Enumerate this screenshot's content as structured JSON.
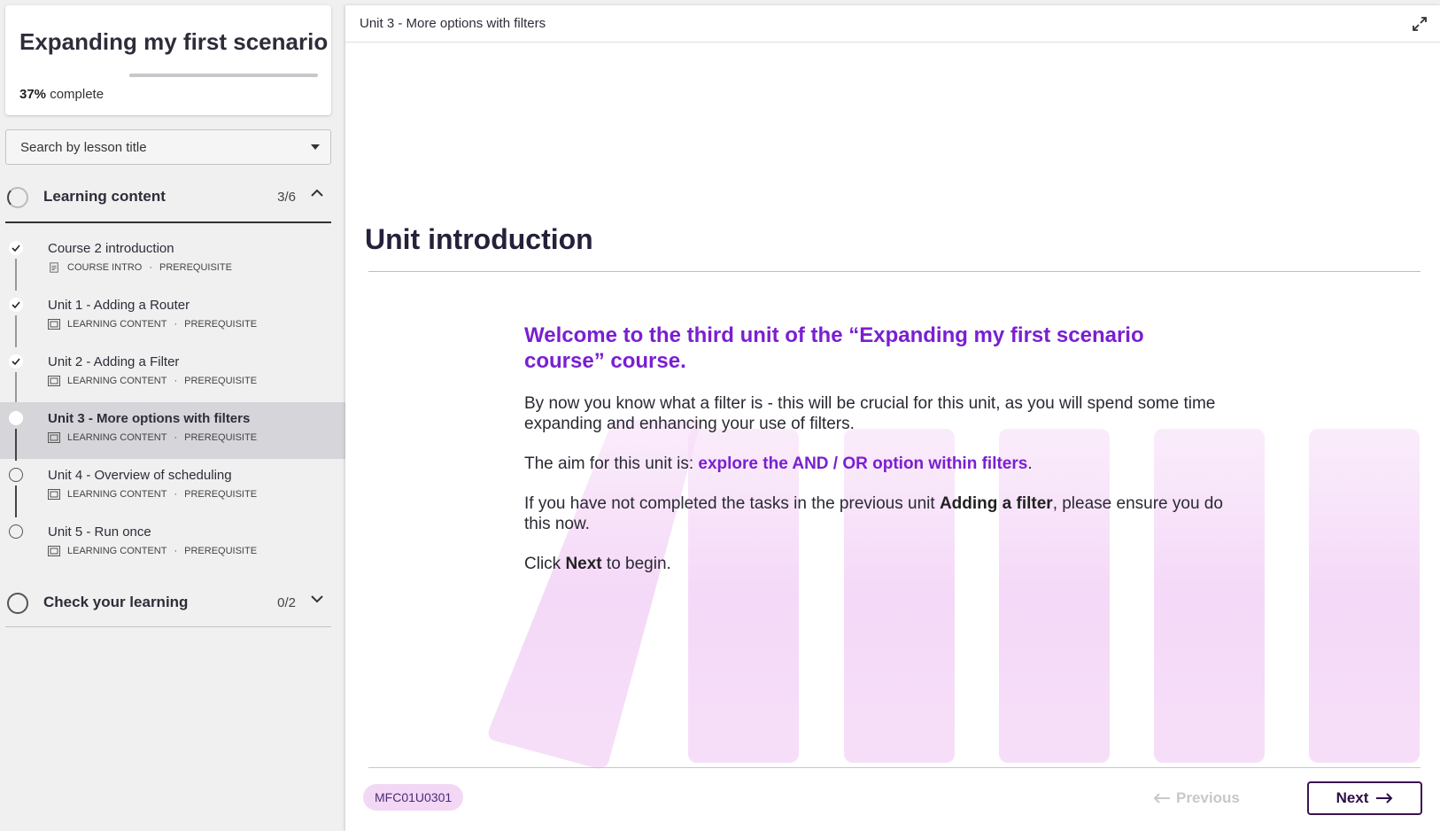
{
  "sidebar": {
    "course_title": "Expanding my first scenario",
    "progress_percent": "37%",
    "progress_suffix": "complete",
    "progress_value": 0.37,
    "search_placeholder": "Search by lesson title",
    "sections": [
      {
        "title": "Learning content",
        "count": "3/6",
        "expanded": true
      },
      {
        "title": "Check your learning",
        "count": "0/2",
        "expanded": false
      }
    ],
    "lessons": [
      {
        "name": "Course 2 introduction",
        "type": "COURSE INTRO",
        "tag": "PREREQUISITE",
        "status": "done"
      },
      {
        "name": "Unit 1 - Adding a Router",
        "type": "LEARNING CONTENT",
        "tag": "PREREQUISITE",
        "status": "done"
      },
      {
        "name": "Unit 2 - Adding a Filter",
        "type": "LEARNING CONTENT",
        "tag": "PREREQUISITE",
        "status": "done"
      },
      {
        "name": "Unit 3 - More options with filters",
        "type": "LEARNING CONTENT",
        "tag": "PREREQUISITE",
        "status": "current"
      },
      {
        "name": "Unit 4 - Overview of scheduling",
        "type": "LEARNING CONTENT",
        "tag": "PREREQUISITE",
        "status": "open"
      },
      {
        "name": "Unit 5 - Run once",
        "type": "LEARNING CONTENT",
        "tag": "PREREQUISITE",
        "status": "open"
      }
    ],
    "meta_separator": "·"
  },
  "main": {
    "breadcrumb": "Unit 3 - More options with filters",
    "heading": "Unit introduction",
    "welcome": "Welcome to the third unit of the “Expanding my first scenario course” course.",
    "para1": "By now you know what a filter is - this will be crucial for this unit, as you will spend some time expanding and enhancing your use of filters.",
    "para2_prefix": "The aim for this unit is: ",
    "para2_highlight": "explore the AND / OR option within filters",
    "para2_suffix": ".",
    "para3_prefix": "If you have not completed the tasks in the previous unit ",
    "para3_bold": "Adding a filter",
    "para3_suffix": ", please ensure you do this now.",
    "para4_prefix": "Click ",
    "para4_bold": "Next",
    "para4_suffix": " to begin.",
    "code": "MFC01U0301",
    "previous_label": "Previous",
    "next_label": "Next"
  },
  "colors": {
    "accent_purple": "#7a1fd1",
    "next_border": "#3a1450",
    "badge_bg": "#f3d8f5",
    "stripe": "#f4d6f7"
  }
}
